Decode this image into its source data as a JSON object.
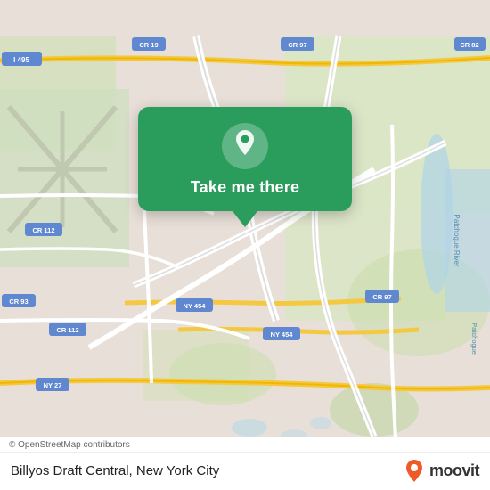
{
  "map": {
    "attribution": "© OpenStreetMap contributors",
    "background_color": "#e8e0d8"
  },
  "popup": {
    "button_label": "Take me there",
    "icon": "location-pin"
  },
  "bottom_bar": {
    "place_name": "Billyos Draft Central, New York City",
    "moovit_label": "moovit"
  }
}
